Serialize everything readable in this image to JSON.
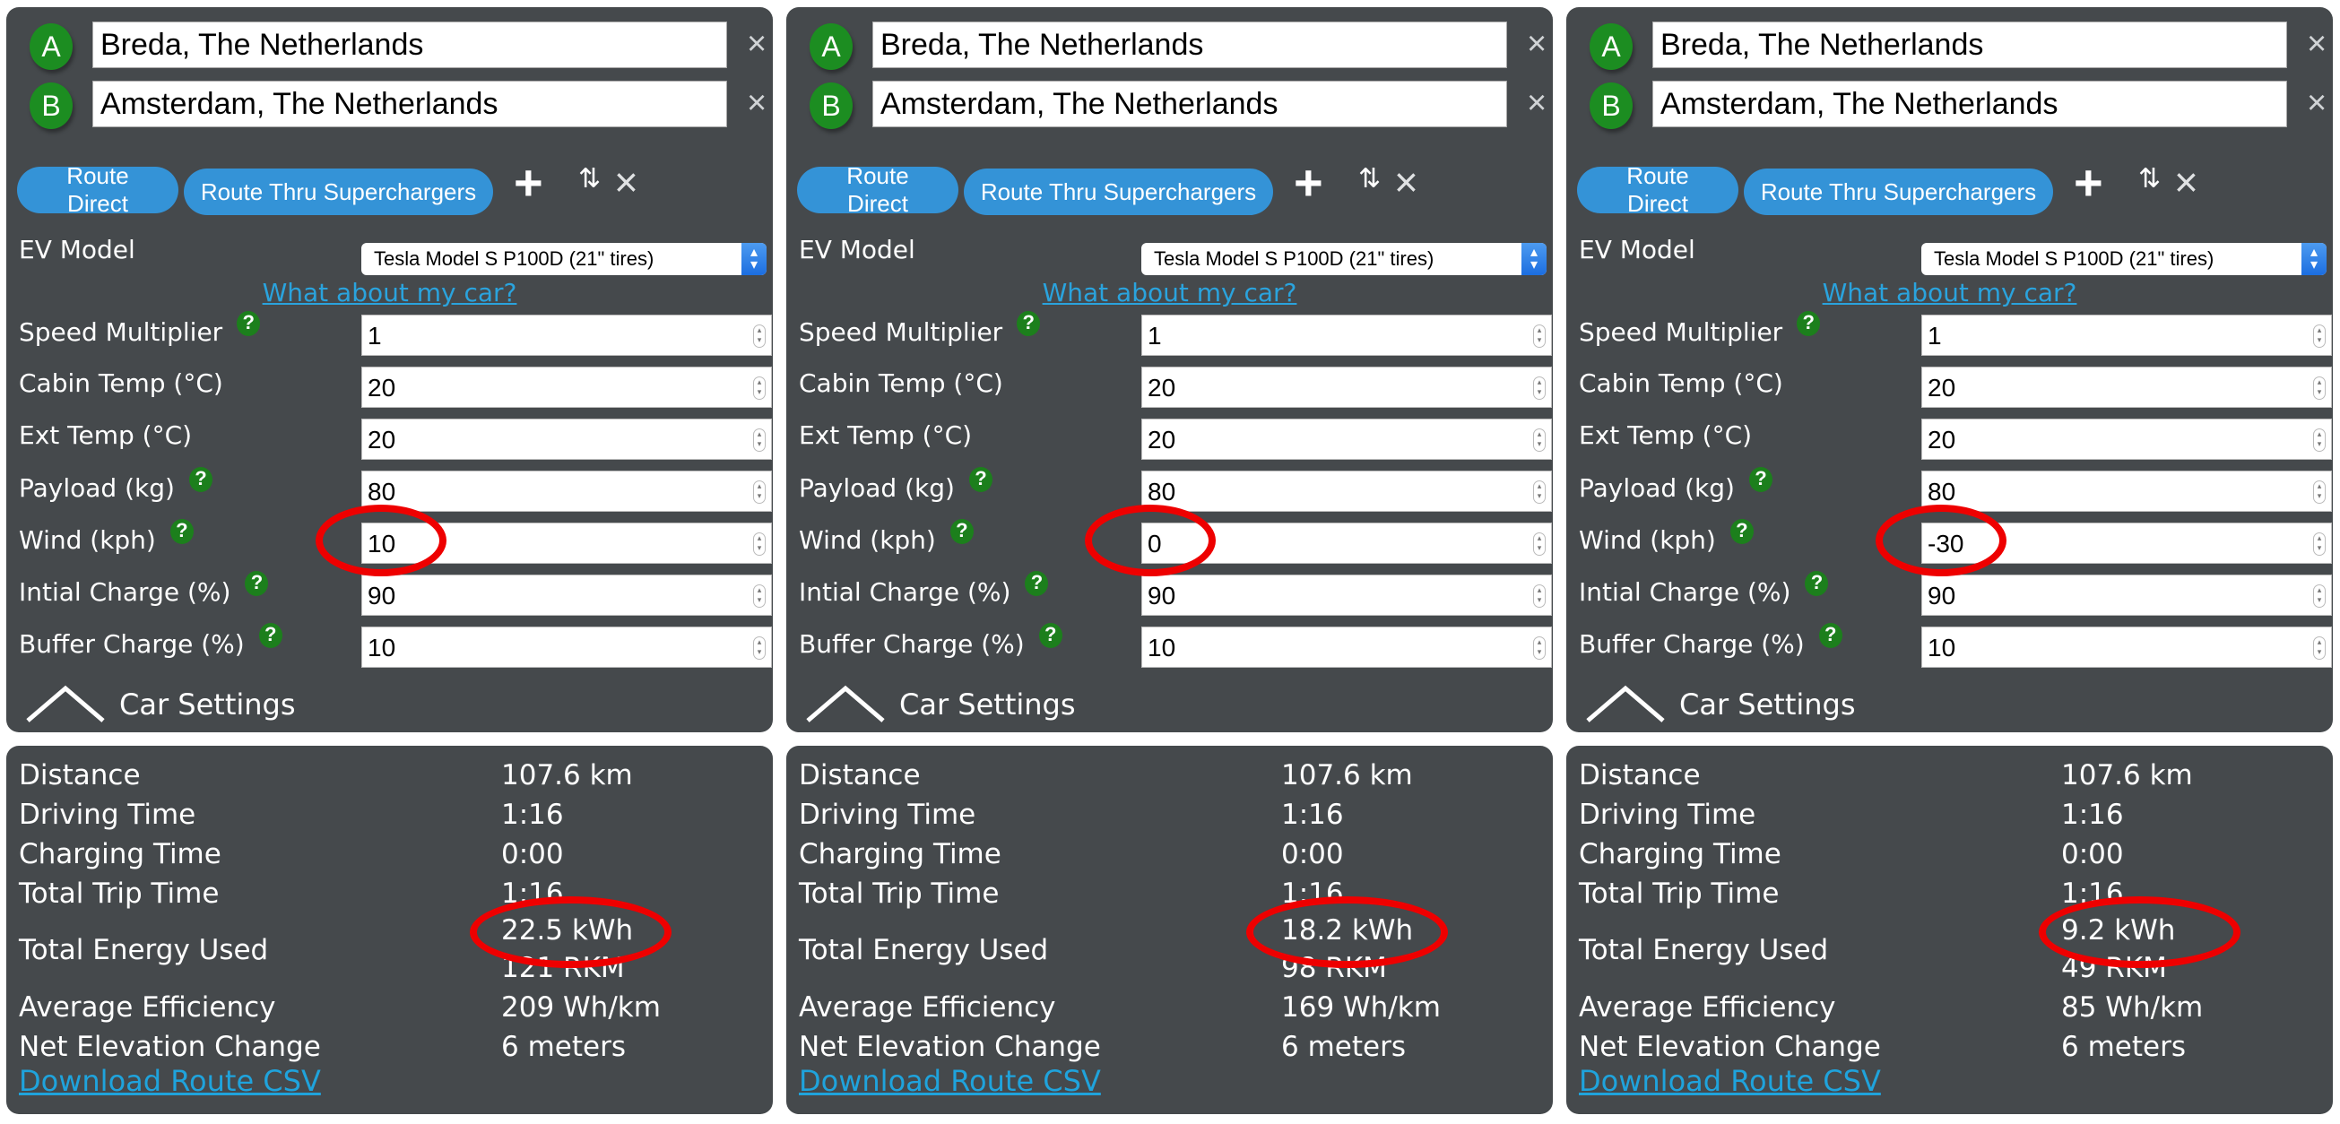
{
  "common": {
    "waypoints": [
      {
        "badge": "A",
        "value": "Breda, The Netherlands"
      },
      {
        "badge": "B",
        "value": "Amsterdam, The Netherlands"
      }
    ],
    "remove_icon": "×",
    "buttons": {
      "route_direct": "Route Direct",
      "route_thru": "Route Thru Superchargers"
    },
    "icons": {
      "add_waypoint": "+",
      "swap": "⇅",
      "clear": "×",
      "help": "?",
      "select_chevron": "⌃⌄",
      "spinner": "⌃⌄"
    },
    "ev_model_label": "EV Model",
    "ev_model_selected": "Tesla Model S P100D (21\" tires)",
    "car_link": "What about my car?",
    "setting_labels": {
      "speed": "Speed Multiplier",
      "cabin": "Cabin Temp (°C)",
      "ext": "Ext Temp (°C)",
      "payload": "Payload (kg)",
      "wind": "Wind (kph)",
      "initial": "Intial Charge (%)",
      "buffer": "Buffer Charge (%)"
    },
    "collapse_label": "Car Settings",
    "result_labels": {
      "distance": "Distance",
      "driving": "Driving Time",
      "charging": "Charging Time",
      "total_trip": "Total Trip Time",
      "energy": "Total Energy Used",
      "efficiency": "Average Efficiency",
      "elevation": "Net Elevation Change"
    },
    "csv_link": "Download Route CSV",
    "annotation_color": "#ee0000",
    "accent_green": "#1c8d21",
    "accent_blue": "#3493d7"
  },
  "panels": [
    {
      "settings": {
        "speed": "1",
        "cabin": "20",
        "ext": "20",
        "payload": "80",
        "wind": "10",
        "initial": "90",
        "buffer": "10"
      },
      "results": {
        "distance": "107.6 km",
        "driving": "1:16",
        "charging": "0:00",
        "total_trip": "1:16",
        "energy": "22.5 kWh",
        "energy_rkm": "121 RKM",
        "efficiency": "209 Wh/km",
        "elevation": "6 meters"
      }
    },
    {
      "settings": {
        "speed": "1",
        "cabin": "20",
        "ext": "20",
        "payload": "80",
        "wind": "0",
        "initial": "90",
        "buffer": "10"
      },
      "results": {
        "distance": "107.6 km",
        "driving": "1:16",
        "charging": "0:00",
        "total_trip": "1:16",
        "energy": "18.2 kWh",
        "energy_rkm": "98 RKM",
        "efficiency": "169 Wh/km",
        "elevation": "6 meters"
      }
    },
    {
      "settings": {
        "speed": "1",
        "cabin": "20",
        "ext": "20",
        "payload": "80",
        "wind": "-30",
        "initial": "90",
        "buffer": "10"
      },
      "results": {
        "distance": "107.6 km",
        "driving": "1:16",
        "charging": "0:00",
        "total_trip": "1:16",
        "energy": "9.2 kWh",
        "energy_rkm": "49 RKM",
        "efficiency": "85 Wh/km",
        "elevation": "6 meters"
      }
    }
  ]
}
